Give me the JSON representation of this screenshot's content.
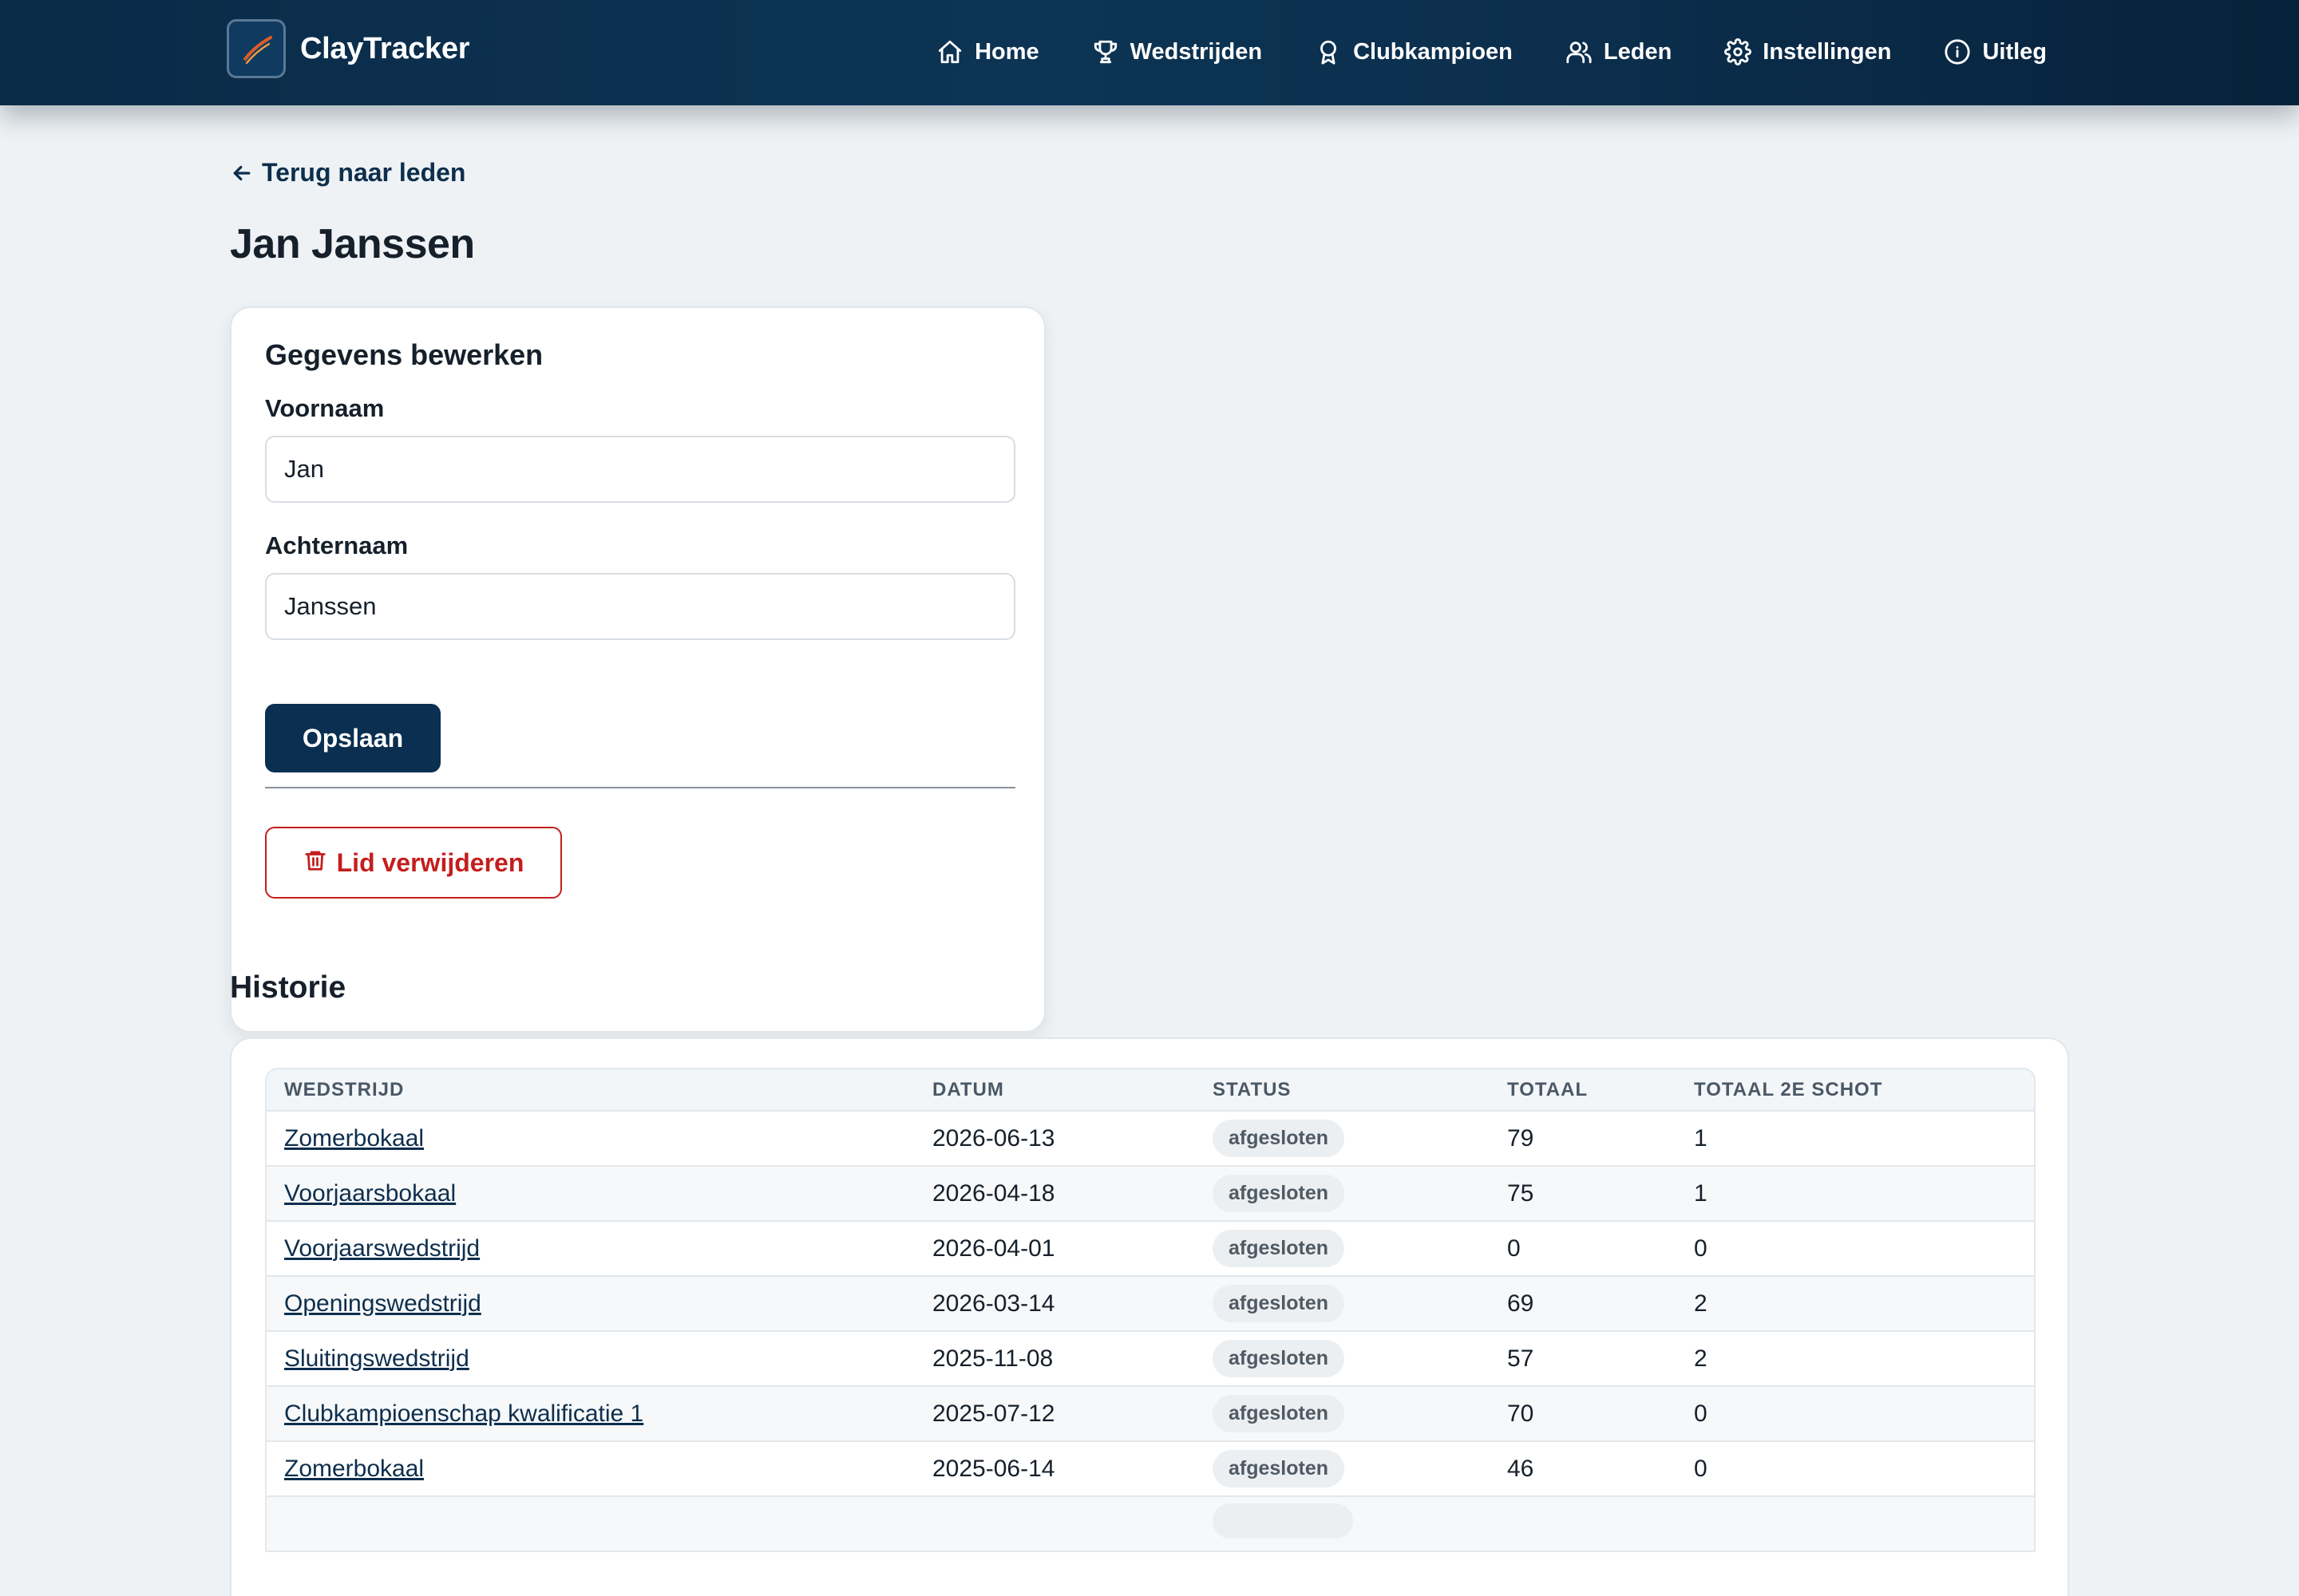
{
  "app": {
    "name": "ClayTracker"
  },
  "nav": {
    "items": [
      {
        "label": "Home",
        "icon": "home-icon"
      },
      {
        "label": "Wedstrijden",
        "icon": "trophy-icon"
      },
      {
        "label": "Clubkampioen",
        "icon": "award-icon"
      },
      {
        "label": "Leden",
        "icon": "users-icon"
      },
      {
        "label": "Instellingen",
        "icon": "gear-icon"
      },
      {
        "label": "Uitleg",
        "icon": "info-icon"
      }
    ]
  },
  "page": {
    "back_label": "Terug naar leden",
    "title": "Jan Janssen"
  },
  "edit_form": {
    "title": "Gegevens bewerken",
    "first_name_label": "Voornaam",
    "first_name_value": "Jan",
    "last_name_label": "Achternaam",
    "last_name_value": "Janssen",
    "save_label": "Opslaan",
    "delete_label": "Lid verwijderen"
  },
  "history": {
    "title": "Historie",
    "columns": [
      "WEDSTRIJD",
      "DATUM",
      "STATUS",
      "TOTAAL",
      "TOTAAL 2E SCHOT"
    ],
    "rows": [
      {
        "match": "Zomerbokaal",
        "date": "2026-06-13",
        "status": "afgesloten",
        "total": "79",
        "total_second": "1"
      },
      {
        "match": "Voorjaarsbokaal",
        "date": "2026-04-18",
        "status": "afgesloten",
        "total": "75",
        "total_second": "1"
      },
      {
        "match": "Voorjaarswedstrijd",
        "date": "2026-04-01",
        "status": "afgesloten",
        "total": "0",
        "total_second": "0"
      },
      {
        "match": "Openingswedstrijd",
        "date": "2026-03-14",
        "status": "afgesloten",
        "total": "69",
        "total_second": "2"
      },
      {
        "match": "Sluitingswedstrijd",
        "date": "2025-11-08",
        "status": "afgesloten",
        "total": "57",
        "total_second": "2"
      },
      {
        "match": "Clubkampioenschap kwalificatie 1",
        "date": "2025-07-12",
        "status": "afgesloten",
        "total": "70",
        "total_second": "0"
      },
      {
        "match": "Zomerbokaal",
        "date": "2025-06-14",
        "status": "afgesloten",
        "total": "46",
        "total_second": "0"
      }
    ]
  },
  "colors": {
    "primary": "#0a2f50",
    "danger": "#c51d1d",
    "background": "#eef2f4"
  }
}
